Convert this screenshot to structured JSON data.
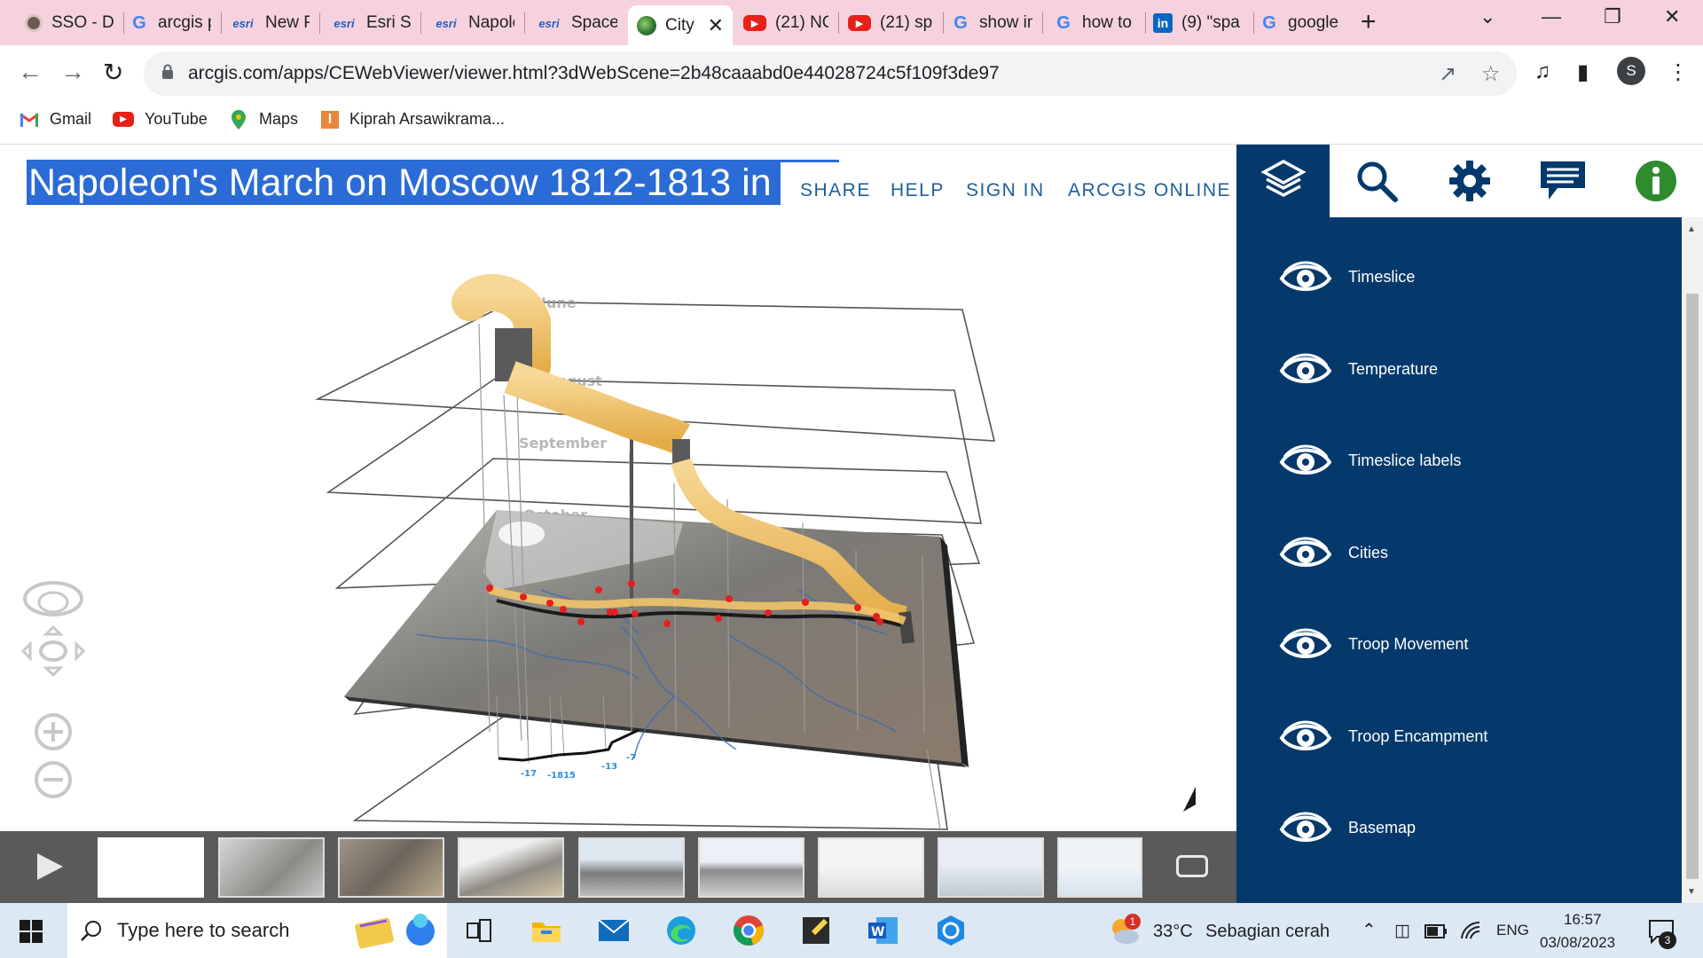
{
  "browser": {
    "tabs": [
      {
        "title": "SSO - D",
        "icon": "sso-icon"
      },
      {
        "title": "arcgis p",
        "icon": "google-icon"
      },
      {
        "title": "New Po",
        "icon": "esri-icon"
      },
      {
        "title": "Esri Sea",
        "icon": "esri-icon"
      },
      {
        "title": "Napole",
        "icon": "esri-icon"
      },
      {
        "title": "Space-",
        "icon": "esri-icon"
      },
      {
        "title": "City",
        "icon": "globe-icon",
        "active": true
      },
      {
        "title": "(21) NC",
        "icon": "youtube-icon"
      },
      {
        "title": "(21) sp",
        "icon": "youtube-icon"
      },
      {
        "title": "show in",
        "icon": "google-icon"
      },
      {
        "title": "how to",
        "icon": "google-icon"
      },
      {
        "title": "(9) \"spa",
        "icon": "linkedin-icon"
      },
      {
        "title": "google",
        "icon": "google-icon"
      }
    ],
    "url": "arcgis.com/apps/CEWebViewer/viewer.html?3dWebScene=2b48caaabd0e44028724c5f109f3de97",
    "profile_initial": "S",
    "bookmarks": [
      {
        "label": "Gmail",
        "icon": "gmail-icon"
      },
      {
        "label": "YouTube",
        "icon": "youtube-icon"
      },
      {
        "label": "Maps",
        "icon": "maps-icon"
      },
      {
        "label": "Kiprah Arsawikrama...",
        "icon": "bookmark-site-icon"
      }
    ]
  },
  "app": {
    "title": "Napoleon's March on Moscow 1812-1813 in",
    "nav": [
      "SHARE",
      "HELP",
      "SIGN IN",
      "ARCGIS ONLINE"
    ],
    "tools": [
      "layers-icon",
      "search-icon",
      "settings-icon",
      "comments-icon",
      "info-icon"
    ],
    "layers": [
      "Timeslice",
      "Temperature",
      "Timeslice labels",
      "Cities",
      "Troop Movement",
      "Troop Encampment",
      "Basemap"
    ],
    "scene_labels": {
      "months": [
        "June",
        "August",
        "September",
        "October"
      ],
      "temperatures": [
        "-17",
        "-1815",
        "-13",
        "-7"
      ]
    },
    "tour": {
      "slide_count": 9,
      "selected_slide": 1
    }
  },
  "colors": {
    "panel": "#05396b",
    "title_highlight": "#2a6bd6",
    "nav_text": "#1f5f99",
    "troop_path": "#f1c46a",
    "tour_bar": "#5a5a5a"
  },
  "taskbar": {
    "search_placeholder": "Type here to search",
    "weather_temp": "33°C",
    "weather_text": "Sebagian cerah",
    "language": "ENG",
    "time": "16:57",
    "date": "03/08/2023",
    "notification_count": "3",
    "weather_badge": "1"
  }
}
